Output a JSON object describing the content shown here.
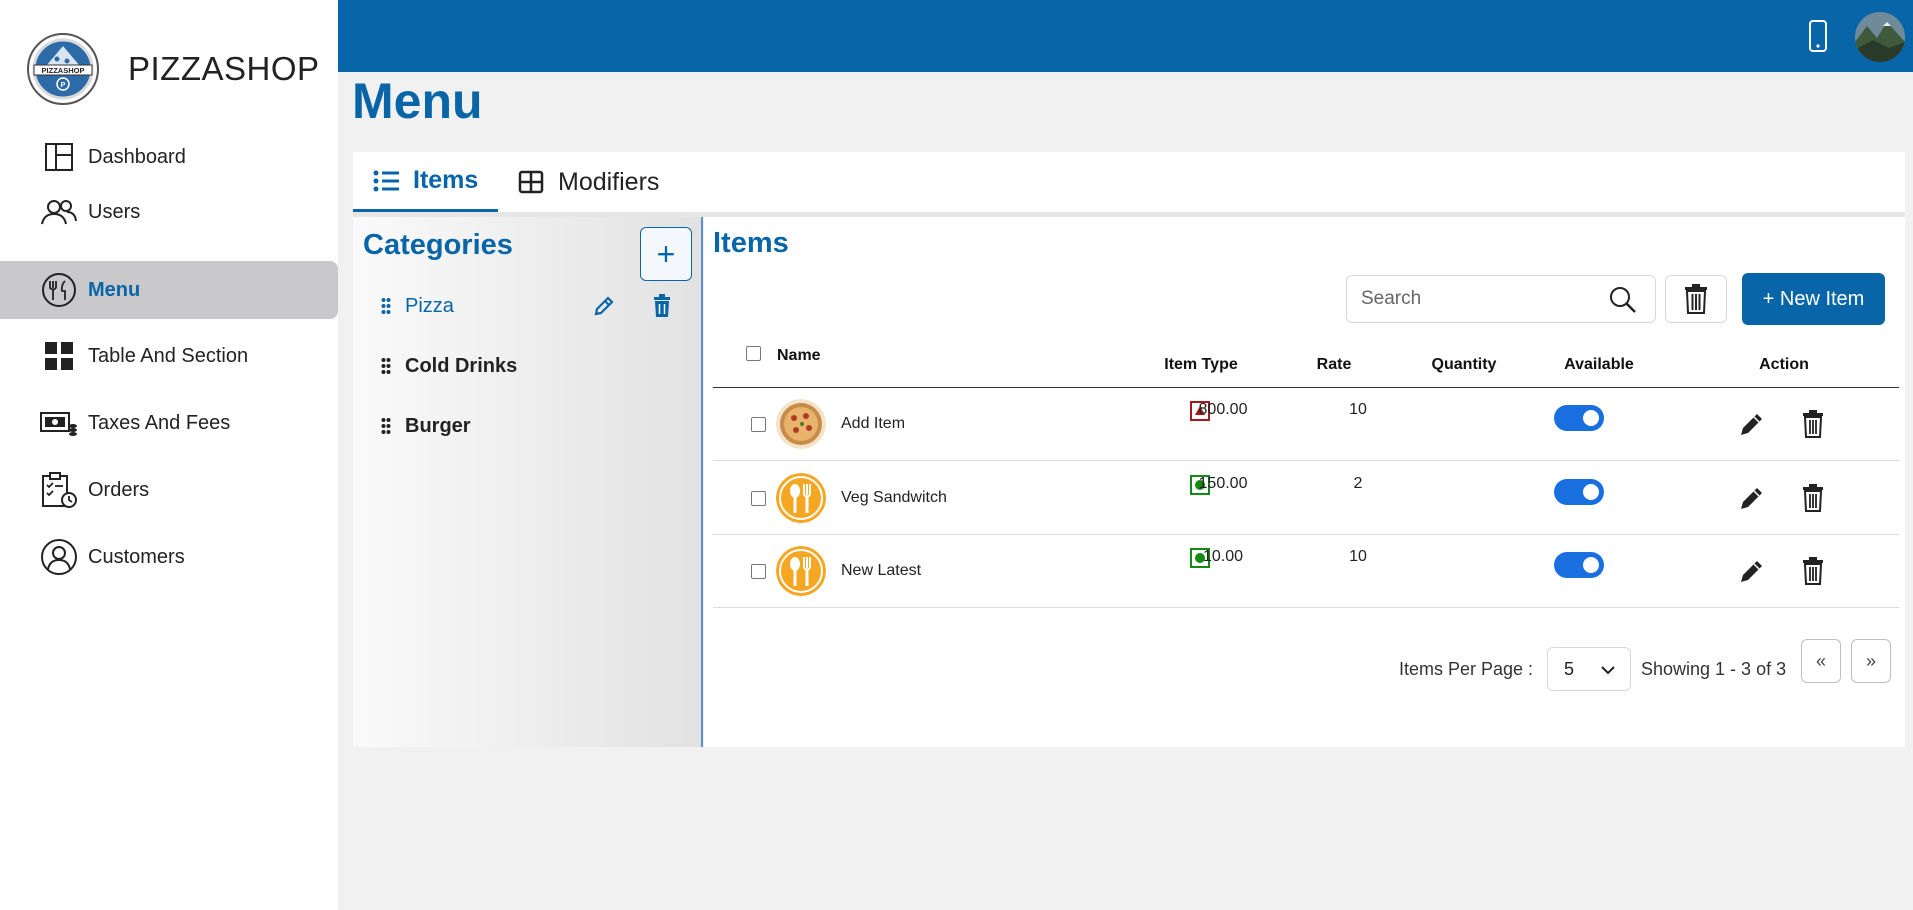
{
  "brand": {
    "name": "PIZZASHOP",
    "logo_text": "PIZZASHOP"
  },
  "sidebar": {
    "items": [
      {
        "label": "Dashboard",
        "icon": "dashboard-icon"
      },
      {
        "label": "Users",
        "icon": "users-icon"
      },
      {
        "label": "Menu",
        "icon": "menu-icon",
        "active": true
      },
      {
        "label": "Table And Section",
        "icon": "grid-icon"
      },
      {
        "label": "Taxes And Fees",
        "icon": "money-icon"
      },
      {
        "label": "Orders",
        "icon": "clipboard-icon"
      },
      {
        "label": "Customers",
        "icon": "customer-icon"
      }
    ]
  },
  "page": {
    "title": "Menu"
  },
  "tabs": [
    {
      "label": "Items",
      "icon": "list-icon",
      "active": true
    },
    {
      "label": "Modifiers",
      "icon": "table-icon"
    }
  ],
  "categories": {
    "title": "Categories",
    "add_label": "+",
    "items": [
      {
        "label": "Pizza",
        "active": true
      },
      {
        "label": "Cold Drinks"
      },
      {
        "label": "Burger"
      }
    ]
  },
  "items": {
    "title": "Items",
    "search_placeholder": "Search",
    "new_item_label": "+ New Item",
    "columns": [
      "Name",
      "Item Type",
      "Rate",
      "Quantity",
      "Available",
      "Action"
    ],
    "rows": [
      {
        "name": "Add Item",
        "type": "non-veg",
        "rate": "800.00",
        "quantity": "10",
        "available": true,
        "image": "pizza"
      },
      {
        "name": "Veg Sandwitch",
        "type": "veg",
        "rate": "150.00",
        "quantity": "2",
        "available": true,
        "image": "placeholder"
      },
      {
        "name": "New Latest",
        "type": "veg",
        "rate": "10.00",
        "quantity": "10",
        "available": true,
        "image": "placeholder"
      }
    ]
  },
  "pagination": {
    "per_page_label": "Items Per Page :",
    "per_page_value": "5",
    "showing": "Showing 1 - 3 of 3",
    "prev": "«",
    "next": "»"
  },
  "colors": {
    "primary": "#0866a8",
    "toggle": "#1a6fe0",
    "veg": "#138a13",
    "nonveg": "#a81818"
  }
}
